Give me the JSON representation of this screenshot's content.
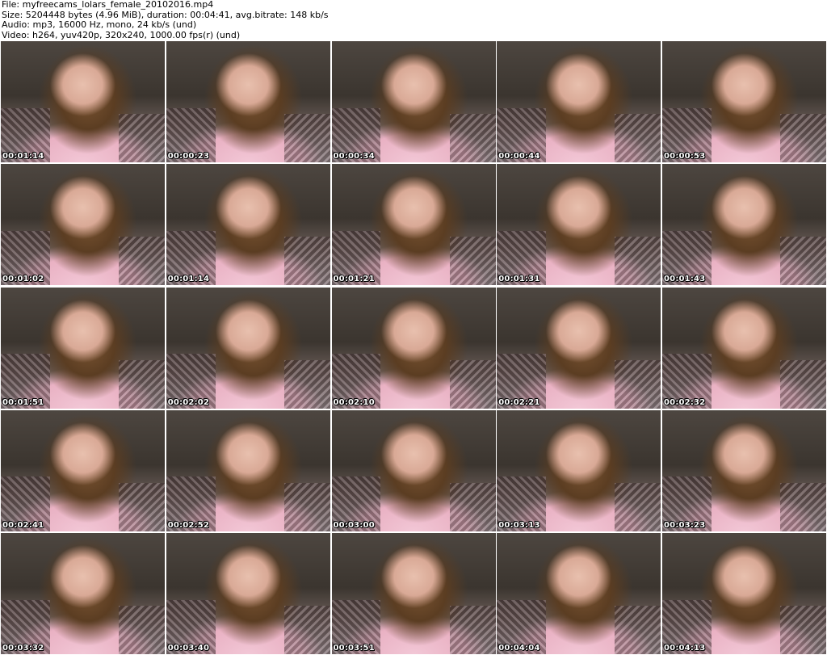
{
  "header": {
    "file": "File: myfreecams_lolars_female_20102016.mp4",
    "size": "Size: 5204448 bytes (4.96 MiB), duration: 00:04:41, avg.bitrate: 148 kb/s",
    "audio": "Audio: mp3, 16000 Hz, mono, 24 kb/s (und)",
    "video": "Video: h264, yuv420p, 320x240, 1000.00 fps(r) (und)"
  },
  "thumbnails": [
    {
      "timestamp": "00:01:14"
    },
    {
      "timestamp": "00:00:23"
    },
    {
      "timestamp": "00:00:34"
    },
    {
      "timestamp": "00:00:44"
    },
    {
      "timestamp": "00:00:53"
    },
    {
      "timestamp": "00:01:02"
    },
    {
      "timestamp": "00:01:14"
    },
    {
      "timestamp": "00:01:21"
    },
    {
      "timestamp": "00:01:31"
    },
    {
      "timestamp": "00:01:43"
    },
    {
      "timestamp": "00:01:51"
    },
    {
      "timestamp": "00:02:02"
    },
    {
      "timestamp": "00:02:10"
    },
    {
      "timestamp": "00:02:21"
    },
    {
      "timestamp": "00:02:32"
    },
    {
      "timestamp": "00:02:41"
    },
    {
      "timestamp": "00:02:52"
    },
    {
      "timestamp": "00:03:00"
    },
    {
      "timestamp": "00:03:13"
    },
    {
      "timestamp": "00:03:23"
    },
    {
      "timestamp": "00:03:32"
    },
    {
      "timestamp": "00:03:40"
    },
    {
      "timestamp": "00:03:51"
    },
    {
      "timestamp": "00:04:04"
    },
    {
      "timestamp": "00:04:13"
    }
  ]
}
